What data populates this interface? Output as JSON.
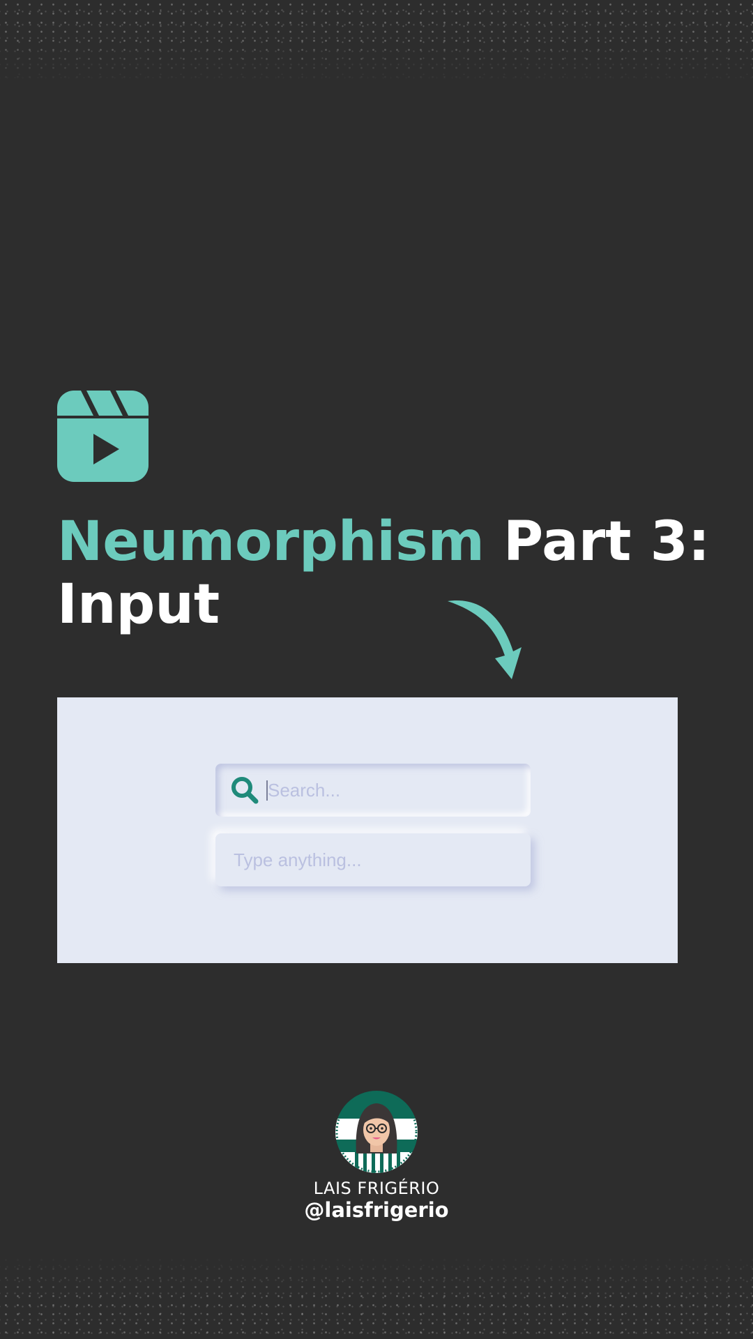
{
  "headline": {
    "accent_word": "Neumorphism",
    "rest_line1": " Part 3:",
    "line2": "Input"
  },
  "search_input": {
    "placeholder": "Search..."
  },
  "text_input": {
    "placeholder": "Type anything..."
  },
  "author": {
    "name": "LAIS FRIGÉRIO",
    "handle": "@laisfrigerio"
  },
  "icons": {
    "reels": "reels-icon",
    "arrow": "curved-arrow-icon",
    "search": "search-icon",
    "avatar": "avatar-illustration"
  },
  "colors": {
    "background": "#2d2d2d",
    "accent": "#6ccbbd",
    "panel": "#e4e9f4",
    "placeholder": "#bac0e0",
    "search_icon": "#1f8a7a",
    "text": "#ffffff"
  }
}
